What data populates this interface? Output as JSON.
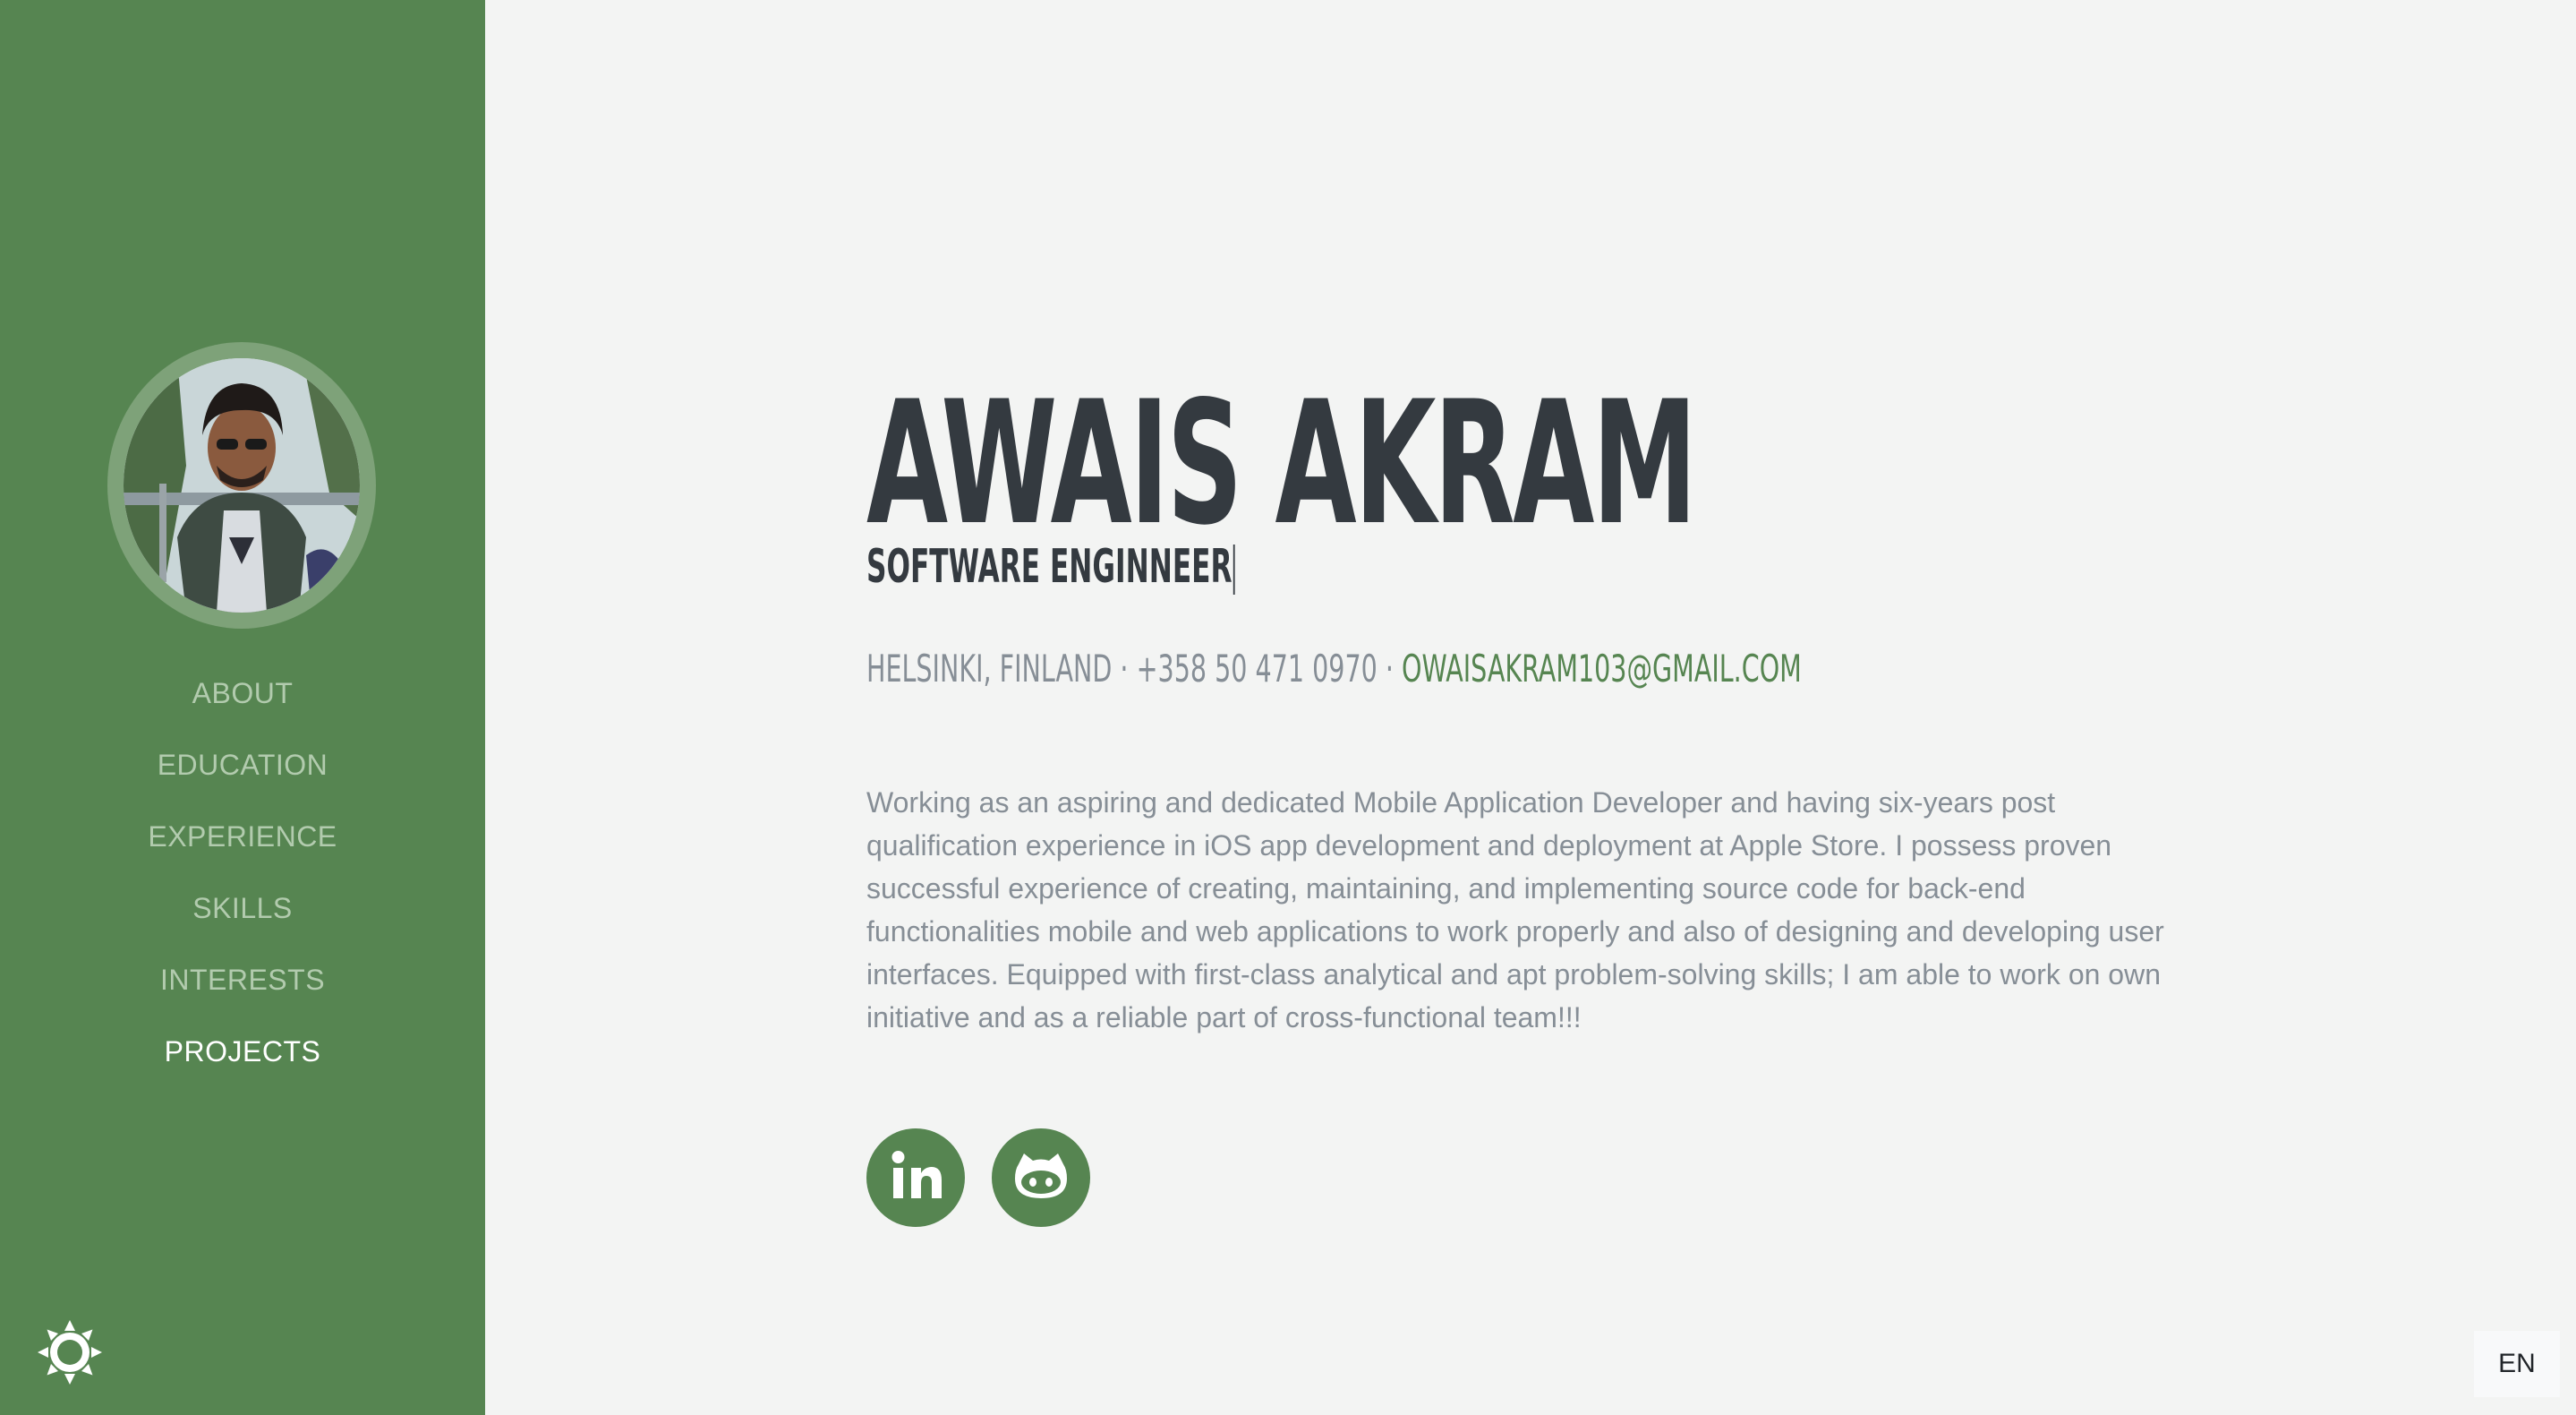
{
  "sidebar": {
    "avatar_alt": "Profile photo",
    "nav": [
      {
        "label": "ABOUT"
      },
      {
        "label": "EDUCATION"
      },
      {
        "label": "EXPERIENCE"
      },
      {
        "label": "SKILLS"
      },
      {
        "label": "INTERESTS"
      },
      {
        "label": "PROJECTS"
      }
    ],
    "theme_toggle_icon": "sun-icon"
  },
  "profile": {
    "name": "AWAIS AKRAM",
    "title": "SOFTWARE ENGINNEER",
    "location": "HELSINKI, FINLAND",
    "separator": "·",
    "phone": "+358 50 471 0970",
    "email": "OWAISAKRAM103@GMAIL.COM",
    "bio": "Working as an aspiring and dedicated Mobile Application Developer and having six-years post qualification experience in iOS app development and deployment at Apple Store. I possess proven successful experience of creating, maintaining, and implementing source code for back-end functionalities mobile and web applications to work properly and also of designing and developing user interfaces. Equipped with first-class analytical and apt problem-solving skills; I am able to work on own initiative and as a reliable part of cross-functional team!!!"
  },
  "social": [
    {
      "icon": "linkedin-icon"
    },
    {
      "icon": "github-icon"
    }
  ],
  "language": {
    "label": "EN"
  },
  "colors": {
    "sidebar": "#568551",
    "background": "#f3f4f3",
    "heading": "#343a40",
    "muted": "#868e96",
    "nav_inactive": "#b2cbae",
    "nav_active": "#ffffff"
  }
}
